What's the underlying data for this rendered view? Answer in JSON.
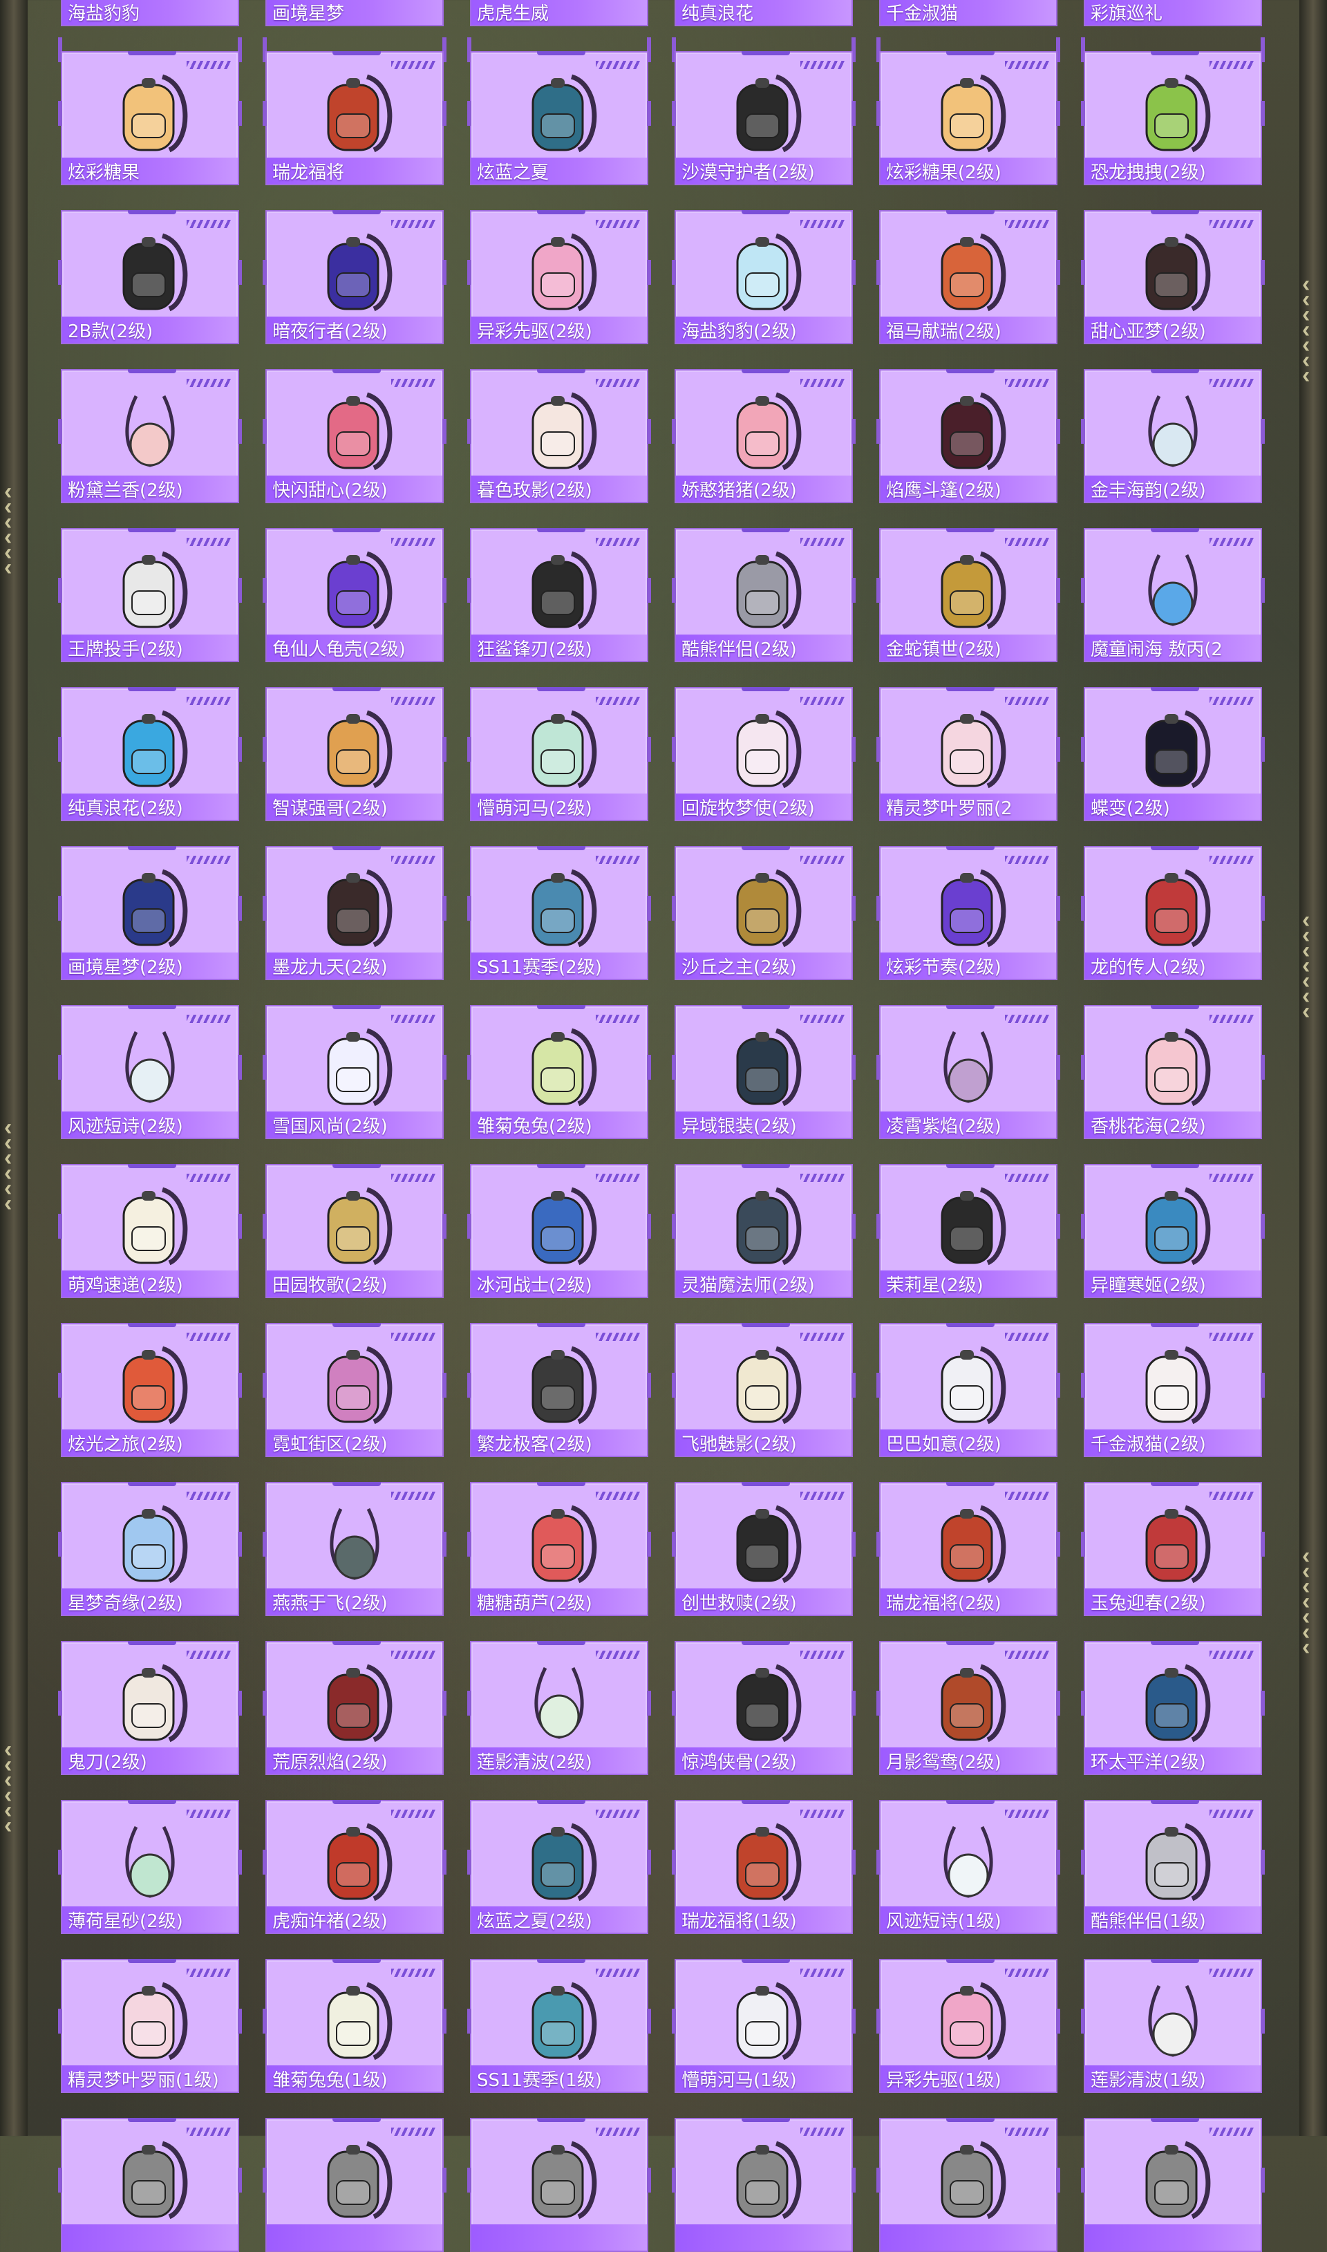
{
  "colors": {
    "card_bg": "#d9b3ff",
    "card_border": "#a06be0",
    "label_bar": "#9d5cff",
    "accent": "#7b4fd8"
  },
  "partial_top_row": [
    {
      "label": "海盐豹豹",
      "icon": "backpack-icon"
    },
    {
      "label": "画境星梦",
      "icon": "backpack-icon"
    },
    {
      "label": "虎虎生威",
      "icon": "backpack-icon"
    },
    {
      "label": "纯真浪花",
      "icon": "backpack-icon"
    },
    {
      "label": "千金淑猫",
      "icon": "backpack-icon"
    },
    {
      "label": "彩旗巡礼",
      "icon": "backpack-icon"
    }
  ],
  "items": [
    {
      "label": "炫彩糖果",
      "icon": "candy-backpack-icon",
      "color": "#f2c27a"
    },
    {
      "label": "瑞龙福将",
      "icon": "dragon-backpack-icon",
      "color": "#c0442c"
    },
    {
      "label": "炫蓝之夏",
      "icon": "backpack-icon",
      "color": "#2f6e88"
    },
    {
      "label": "沙漠守护者(2级)",
      "icon": "backpack-icon",
      "color": "#2a2a2a"
    },
    {
      "label": "炫彩糖果(2级)",
      "icon": "candy-backpack-icon",
      "color": "#f2c27a"
    },
    {
      "label": "恐龙拽拽(2级)",
      "icon": "dino-backpack-icon",
      "color": "#8bc34a"
    },
    {
      "label": "2B款(2级)",
      "icon": "backpack-icon",
      "color": "#2a2a2a"
    },
    {
      "label": "暗夜行者(2级)",
      "icon": "backpack-icon",
      "color": "#3b2fa0"
    },
    {
      "label": "异彩先驱(2级)",
      "icon": "backpack-icon",
      "color": "#f0a6c8"
    },
    {
      "label": "海盐豹豹(2级)",
      "icon": "seal-backpack-icon",
      "color": "#bfe6f5"
    },
    {
      "label": "福马献瑞(2级)",
      "icon": "horse-backpack-icon",
      "color": "#d8643a"
    },
    {
      "label": "甜心亚梦(2级)",
      "icon": "backpack-icon",
      "color": "#3a2a2a"
    },
    {
      "label": "粉黛兰香(2级)",
      "icon": "pouch-icon",
      "color": "#f3c9c9"
    },
    {
      "label": "快闪甜心(2级)",
      "icon": "backpack-icon",
      "color": "#e36a86"
    },
    {
      "label": "暮色玫影(2级)",
      "icon": "doll-backpack-icon",
      "color": "#f5e6e0"
    },
    {
      "label": "娇憨猪猪(2级)",
      "icon": "pig-backpack-icon",
      "color": "#f2a6b8"
    },
    {
      "label": "焰鹰斗篷(2级)",
      "icon": "backpack-icon",
      "color": "#4a1f2a"
    },
    {
      "label": "金丰海韵(2级)",
      "icon": "pouch-icon",
      "color": "#d9e8f2"
    },
    {
      "label": "王牌投手(2级)",
      "icon": "helmet-backpack-icon",
      "color": "#e8e8e8"
    },
    {
      "label": "龟仙人龟壳(2级)",
      "icon": "shell-backpack-icon",
      "color": "#6b3fd0"
    },
    {
      "label": "狂鲨锋刃(2级)",
      "icon": "shark-backpack-icon",
      "color": "#2a2a2a"
    },
    {
      "label": "酷熊伴侣(2级)",
      "icon": "bear-backpack-icon",
      "color": "#9a9aa6"
    },
    {
      "label": "金蛇镇世(2级)",
      "icon": "snake-backpack-icon",
      "color": "#c49a3a"
    },
    {
      "label": "魔童闹海 敖丙(2",
      "icon": "pendant-icon",
      "color": "#5aa8e8"
    },
    {
      "label": "纯真浪花(2级)",
      "icon": "cup-backpack-icon",
      "color": "#3aa8e0"
    },
    {
      "label": "智谋强哥(2级)",
      "icon": "bear-backpack-icon",
      "color": "#e0a050"
    },
    {
      "label": "懵萌河马(2级)",
      "icon": "hippo-backpack-icon",
      "color": "#bfe6d6"
    },
    {
      "label": "回旋牧梦使(2级)",
      "icon": "backpack-icon",
      "color": "#f5e6f0"
    },
    {
      "label": "精灵梦叶罗丽(2",
      "icon": "heart-backpack-icon",
      "color": "#f5d6e0"
    },
    {
      "label": "蝶变(2级)",
      "icon": "backpack-icon",
      "color": "#1a1a2a"
    },
    {
      "label": "画境星梦(2级)",
      "icon": "book-backpack-icon",
      "color": "#2a3a8a"
    },
    {
      "label": "墨龙九天(2级)",
      "icon": "backpack-icon",
      "color": "#3a2a2a"
    },
    {
      "label": "SS11赛季(2级)",
      "icon": "backpack-icon",
      "color": "#4a8ab0"
    },
    {
      "label": "沙丘之主(2级)",
      "icon": "backpack-icon",
      "color": "#b08a3a"
    },
    {
      "label": "炫彩节奏(2级)",
      "icon": "backpack-icon",
      "color": "#6a3fd0"
    },
    {
      "label": "龙的传人(2级)",
      "icon": "backpack-icon",
      "color": "#c03a3a"
    },
    {
      "label": "风迹短诗(2级)",
      "icon": "pouch-icon",
      "color": "#e6f0f5"
    },
    {
      "label": "雪国风尚(2级)",
      "icon": "snowman-backpack-icon",
      "color": "#f0f0ff"
    },
    {
      "label": "雏菊兔兔(2级)",
      "icon": "backpack-icon",
      "color": "#d6e6a6"
    },
    {
      "label": "异域银装(2级)",
      "icon": "backpack-icon",
      "color": "#2a3a4a"
    },
    {
      "label": "凌霄紫焰(2级)",
      "icon": "pendant-icon",
      "color": "#c0a0d0"
    },
    {
      "label": "香桃花海(2级)",
      "icon": "backpack-icon",
      "color": "#f5c6d0"
    },
    {
      "label": "萌鸡速递(2级)",
      "icon": "chick-backpack-icon",
      "color": "#f5f0e0"
    },
    {
      "label": "田园牧歌(2级)",
      "icon": "basket-icon",
      "color": "#d0b060"
    },
    {
      "label": "冰河战士(2级)",
      "icon": "backpack-icon",
      "color": "#3a6ac0"
    },
    {
      "label": "灵猫魔法师(2级)",
      "icon": "cat-backpack-icon",
      "color": "#3a4a5a"
    },
    {
      "label": "茉莉星(2级)",
      "icon": "backpack-icon",
      "color": "#2a2a2a"
    },
    {
      "label": "异瞳寒姬(2级)",
      "icon": "backpack-icon",
      "color": "#3a8ac0"
    },
    {
      "label": "炫光之旅(2级)",
      "icon": "backpack-icon",
      "color": "#e05a3a"
    },
    {
      "label": "霓虹街区(2级)",
      "icon": "backpack-icon",
      "color": "#d080c0"
    },
    {
      "label": "繁龙极客(2级)",
      "icon": "backpack-icon",
      "color": "#3a3a3a"
    },
    {
      "label": "飞驰魅影(2级)",
      "icon": "backpack-icon",
      "color": "#f0e8d0"
    },
    {
      "label": "巴巴如意(2级)",
      "icon": "backpack-icon",
      "color": "#f0f0f5"
    },
    {
      "label": "千金淑猫(2级)",
      "icon": "cat-backpack-icon",
      "color": "#f5f0f0"
    },
    {
      "label": "星梦奇缘(2级)",
      "icon": "swan-backpack-icon",
      "color": "#a0c8f0"
    },
    {
      "label": "燕燕于飞(2级)",
      "icon": "pendant-icon",
      "color": "#5a6a6a"
    },
    {
      "label": "糖糖葫芦(2级)",
      "icon": "backpack-icon",
      "color": "#e05a5a"
    },
    {
      "label": "创世救赎(2级)",
      "icon": "backpack-icon",
      "color": "#2a2a2a"
    },
    {
      "label": "瑞龙福将(2级)",
      "icon": "dragon-backpack-icon",
      "color": "#c0442c"
    },
    {
      "label": "玉兔迎春(2级)",
      "icon": "backpack-icon",
      "color": "#c03a3a"
    },
    {
      "label": "鬼刀(2级)",
      "icon": "backpack-icon",
      "color": "#f0e8e0"
    },
    {
      "label": "荒原烈焰(2级)",
      "icon": "backpack-icon",
      "color": "#8a2a2a"
    },
    {
      "label": "莲影清波(2级)",
      "icon": "pouch-icon",
      "color": "#e0f0e0"
    },
    {
      "label": "惊鸿侠骨(2级)",
      "icon": "backpack-icon",
      "color": "#2a2a2a"
    },
    {
      "label": "月影鸳鸯(2级)",
      "icon": "backpack-icon",
      "color": "#b04a2a"
    },
    {
      "label": "环太平洋(2级)",
      "icon": "backpack-icon",
      "color": "#2a5a8a"
    },
    {
      "label": "薄荷星砂(2级)",
      "icon": "pouch-icon",
      "color": "#c0e6d0"
    },
    {
      "label": "虎痴许褚(2级)",
      "icon": "tiger-backpack-icon",
      "color": "#c03a2a"
    },
    {
      "label": "炫蓝之夏(2级)",
      "icon": "backpack-icon",
      "color": "#2f6e88"
    },
    {
      "label": "瑞龙福将(1级)",
      "icon": "dragon-backpack-icon",
      "color": "#c0442c"
    },
    {
      "label": "风迹短诗(1级)",
      "icon": "pouch-icon",
      "color": "#f0f5f8"
    },
    {
      "label": "酷熊伴侣(1级)",
      "icon": "bear-backpack-icon",
      "color": "#c0c0c8"
    },
    {
      "label": "精灵梦叶罗丽(1级)",
      "icon": "heart-backpack-icon",
      "color": "#f5d6e0"
    },
    {
      "label": "雏菊兔兔(1级)",
      "icon": "backpack-icon",
      "color": "#f0f0e0"
    },
    {
      "label": "SS11赛季(1级)",
      "icon": "backpack-icon",
      "color": "#4a9ab0"
    },
    {
      "label": "懵萌河马(1级)",
      "icon": "hippo-backpack-icon",
      "color": "#f0f0f5"
    },
    {
      "label": "异彩先驱(1级)",
      "icon": "backpack-icon",
      "color": "#f0a6c8"
    },
    {
      "label": "莲影清波(1级)",
      "icon": "pouch-icon",
      "color": "#f0f0f0"
    }
  ],
  "partial_bottom_row": [
    {
      "label": "",
      "icon": "backpack-icon"
    },
    {
      "label": "",
      "icon": "backpack-icon"
    },
    {
      "label": "",
      "icon": "backpack-icon"
    },
    {
      "label": "",
      "icon": "backpack-icon"
    },
    {
      "label": "",
      "icon": "backpack-icon"
    },
    {
      "label": "",
      "icon": "backpack-icon"
    }
  ]
}
